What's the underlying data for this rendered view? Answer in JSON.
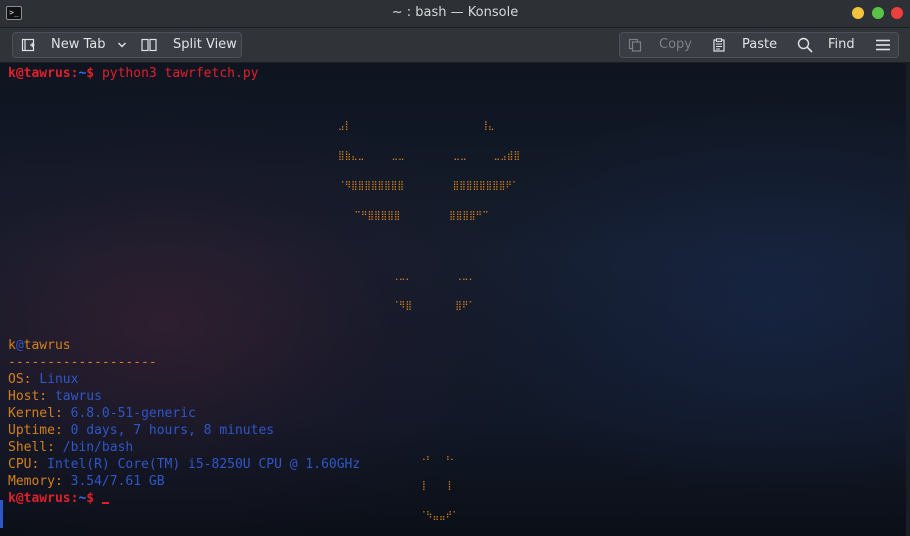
{
  "window": {
    "title": "~ : bash — Konsole",
    "app_icon": ">_",
    "controls": [
      "minimize",
      "maximize",
      "close"
    ],
    "colors": {
      "minimize": "#f2c33e",
      "maximize": "#58c348",
      "close": "#ee3f3f"
    }
  },
  "toolbar": {
    "new_tab": "New Tab",
    "split_view": "Split View",
    "copy": "Copy",
    "paste": "Paste",
    "find": "Find"
  },
  "terminal": {
    "prompt_user": "k",
    "prompt_at": "@",
    "prompt_host": "tawrus",
    "prompt_colon": ":",
    "prompt_path": "~",
    "prompt_dollar": "$ ",
    "command": "python3 tawrfetch.py",
    "art": [
      "⣠⡇                        ⢸⣄",
      "⣿⣷⣄⣀     ⣀⣀         ⣀⣀     ⣀⣠⣾⣿",
      "⠈⠻⣿⣿⣿⣿⣿⣿⣿⣿         ⣿⣿⣿⣿⣿⣿⣿⣿⠟⠁",
      "   ⠉⠛⣿⣿⣿⣿⣿         ⣿⣿⣿⣿⠛⠉",
      "",
      "          ⢀⣀⡀        ⢀⣀⡀",
      "          ⠈⠻⣿        ⣿⠟⠁",
      "",
      "",
      "",
      "",
      "               ⢀⡄  ⢠⡀",
      "               ⢸    ⡇",
      "               ⠈⠳⣤⣤⠞⠁"
    ],
    "info": {
      "user": "k",
      "at": "@",
      "host": "tawrus",
      "separator": "-------------------",
      "rows": [
        {
          "key": "OS: ",
          "value": "Linux"
        },
        {
          "key": "Host: ",
          "value": "tawrus"
        },
        {
          "key": "Kernel: ",
          "value": "6.8.0-51-generic"
        },
        {
          "key": "Uptime: ",
          "value": "0 days, 7 hours, 8 minutes"
        },
        {
          "key": "Shell: ",
          "value": "/bin/bash"
        },
        {
          "key": "CPU: ",
          "value": "Intel(R) Core(TM) i5-8250U CPU @ 1.60GHz"
        },
        {
          "key": "Memory: ",
          "value": "3.54/7.61 GB"
        }
      ]
    },
    "colors": {
      "prompt": "#e0202a",
      "path": "#3a6cf2",
      "keys": "#d4801a",
      "values": "#2f57c8"
    }
  }
}
